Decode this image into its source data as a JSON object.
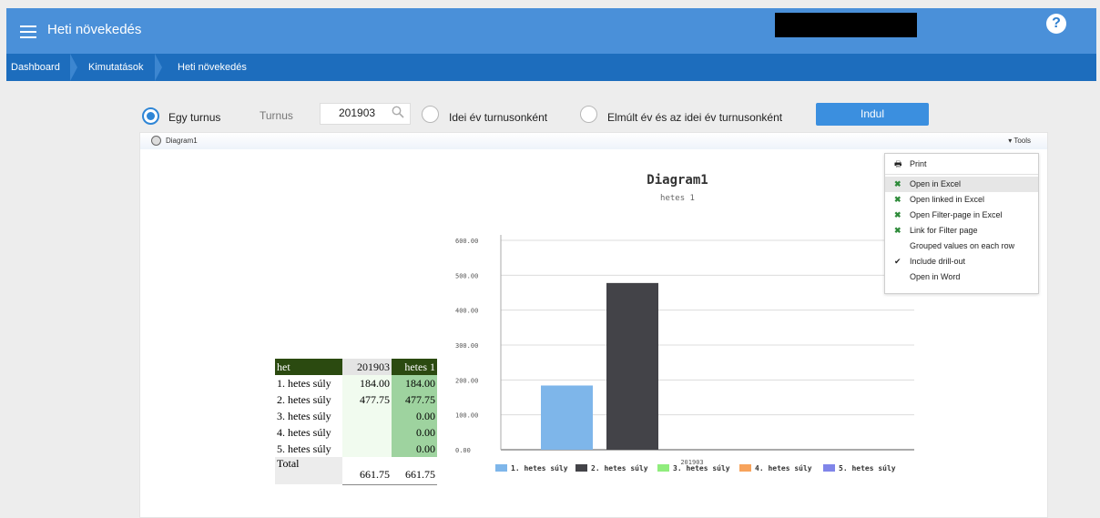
{
  "app": {
    "title": "Heti növekedés",
    "help": "?"
  },
  "breadcrumb": [
    "Dashboard",
    "Kimutatások",
    "Heti növekedés"
  ],
  "filter": {
    "option1": "Egy turnus",
    "turnus_label": "Turnus",
    "turnus_value": "201903",
    "option2": "Idei év turnusonként",
    "option3": "Elmúlt év és az idei év turnusonként",
    "run_label": "Indul"
  },
  "panel": {
    "title": "Diagram1",
    "tools_label": "▾ Tools"
  },
  "table": {
    "headers": [
      "het",
      "201903",
      "hetes 1"
    ],
    "rows": [
      [
        "1. hetes súly",
        "184.00",
        "184.00"
      ],
      [
        "2. hetes súly",
        "477.75",
        "477.75"
      ],
      [
        "3. hetes súly",
        "",
        "0.00"
      ],
      [
        "4. hetes súly",
        "",
        "0.00"
      ],
      [
        "5. hetes súly",
        "",
        "0.00"
      ]
    ],
    "total": [
      "Total",
      "661.75",
      "661.75"
    ]
  },
  "menu": {
    "items": [
      "Print",
      "Open in Excel",
      "Open linked in Excel",
      "Open Filter-page in Excel",
      "Link for Filter page",
      "Grouped values on each row",
      "Include drill-out",
      "Open in Word"
    ]
  },
  "chart_data": {
    "type": "bar",
    "title": "Diagram1",
    "subtitle": "hetes 1",
    "categories": [
      "201903"
    ],
    "series": [
      {
        "name": "1. hetes súly",
        "values": [
          184.0
        ],
        "color": "#7eb6ea"
      },
      {
        "name": "2. hetes súly",
        "values": [
          477.75
        ],
        "color": "#434348"
      },
      {
        "name": "3. hetes súly",
        "values": [
          0
        ],
        "color": "#90ed7d"
      },
      {
        "name": "4. hetes súly",
        "values": [
          0
        ],
        "color": "#f7a35c"
      },
      {
        "name": "5. hetes súly",
        "values": [
          0
        ],
        "color": "#8085e9"
      }
    ],
    "yticks": [
      "0.00",
      "100.00",
      "200.00",
      "300.00",
      "400.00",
      "500.00",
      "600.00"
    ],
    "ylim": [
      0,
      600
    ],
    "legend": "bottom",
    "grid": true
  }
}
